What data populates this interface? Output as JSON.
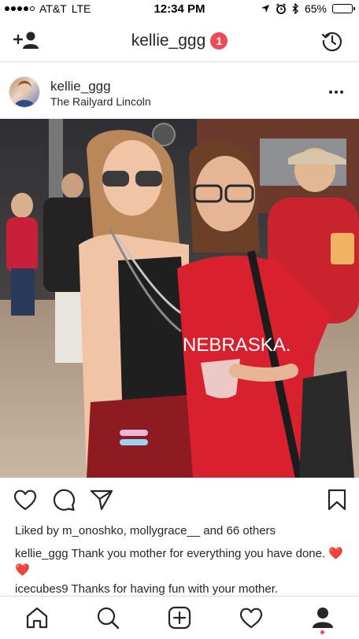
{
  "status_bar": {
    "carrier": "AT&T",
    "network": "LTE",
    "time": "12:34 PM",
    "battery": "65%",
    "battery_level": 0.65
  },
  "header": {
    "title": "kellie_ggg",
    "notification_count": "1",
    "left_icon": "add-person-icon",
    "right_icon": "history-icon"
  },
  "post": {
    "username": "kellie_ggg",
    "location": "The Railyard Lincoln",
    "shirt_text": "NEBRASKA.",
    "likes_prefix": "Liked by ",
    "likes_users": "m_onoshko, mollygrace__",
    "likes_and": " and ",
    "likes_others": "66 others",
    "caption_user": "kellie_ggg",
    "caption_text": " Thank you mother for everything you have done. ",
    "caption_emoji": "❤️❤️",
    "comment_user": "icecubes9",
    "comment_text": " Thanks for having fun with your mother."
  },
  "colors": {
    "accent_red": "#ed4956",
    "divider": "#dbdbdb",
    "text": "#262626"
  },
  "tabs": [
    "home-icon",
    "search-icon",
    "add-post-icon",
    "activity-heart-icon",
    "profile-icon"
  ],
  "active_tab": "profile-icon"
}
